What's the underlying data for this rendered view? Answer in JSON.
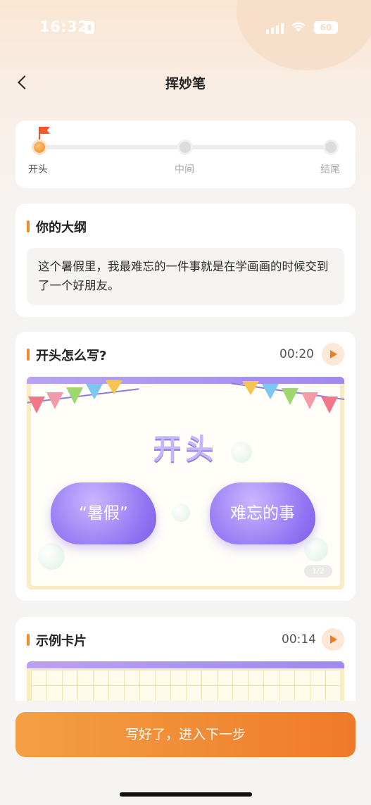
{
  "status_bar": {
    "time": "16:32",
    "battery": "60"
  },
  "nav": {
    "title": "挥妙笔"
  },
  "progress": {
    "steps": [
      "开头",
      "中间",
      "结尾"
    ],
    "current_index": 0
  },
  "outline": {
    "title": "你的大纲",
    "text": "这个暑假里，我最难忘的一件事就是在学画画的时候交到了一个好朋友。"
  },
  "how_to": {
    "title": "开头怎么写?",
    "duration": "00:20",
    "slide": {
      "heading": "开头",
      "bubble_left": "“暑假”",
      "bubble_right": "难忘的事",
      "pager": "1/2"
    }
  },
  "example": {
    "title": "示例卡片",
    "duration": "00:14"
  },
  "cta": {
    "label": "写好了，进入下一步"
  },
  "colors": {
    "accent": "#f08a2e",
    "cta_start": "#f3a044",
    "cta_end": "#ef7a2a",
    "cloud": "#9074f2"
  }
}
